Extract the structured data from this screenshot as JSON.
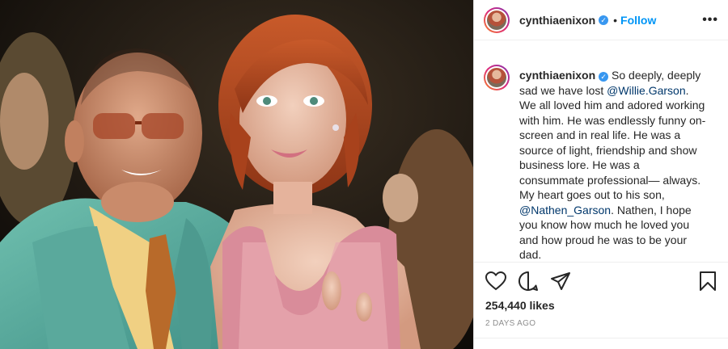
{
  "post": {
    "username": "cynthiaenixon",
    "verified": true,
    "follow_label": "Follow",
    "more_label": "•••",
    "dot": "•",
    "caption": {
      "username": "cynthiaenixon",
      "part1": " So deeply, deeply sad we have lost ",
      "mention1": "@Willie.Garson",
      "part2": ". We all loved him and adored working with him. He was endlessly funny on-screen and in real life. He was a source of light, friendship and show business lore. He was a consummate professional— always. My heart goes out to his son, ",
      "mention2": "@Nathen_Garson",
      "part3": ". Nathen, I hope you know how much he loved you and how proud he was to be your dad.",
      "timestamp_partial": "2d"
    },
    "likes": "254,440 likes",
    "date": "2 DAYS AGO"
  },
  "icons": {
    "verified": "verified-badge-icon",
    "like": "heart-icon",
    "comment": "comment-icon",
    "share": "paper-plane-icon",
    "save": "bookmark-icon",
    "more": "more-options-icon"
  },
  "colors": {
    "accent": "#0095f6",
    "mention": "#00376b",
    "muted": "#8e8e8e",
    "verified": "#3897f0"
  }
}
